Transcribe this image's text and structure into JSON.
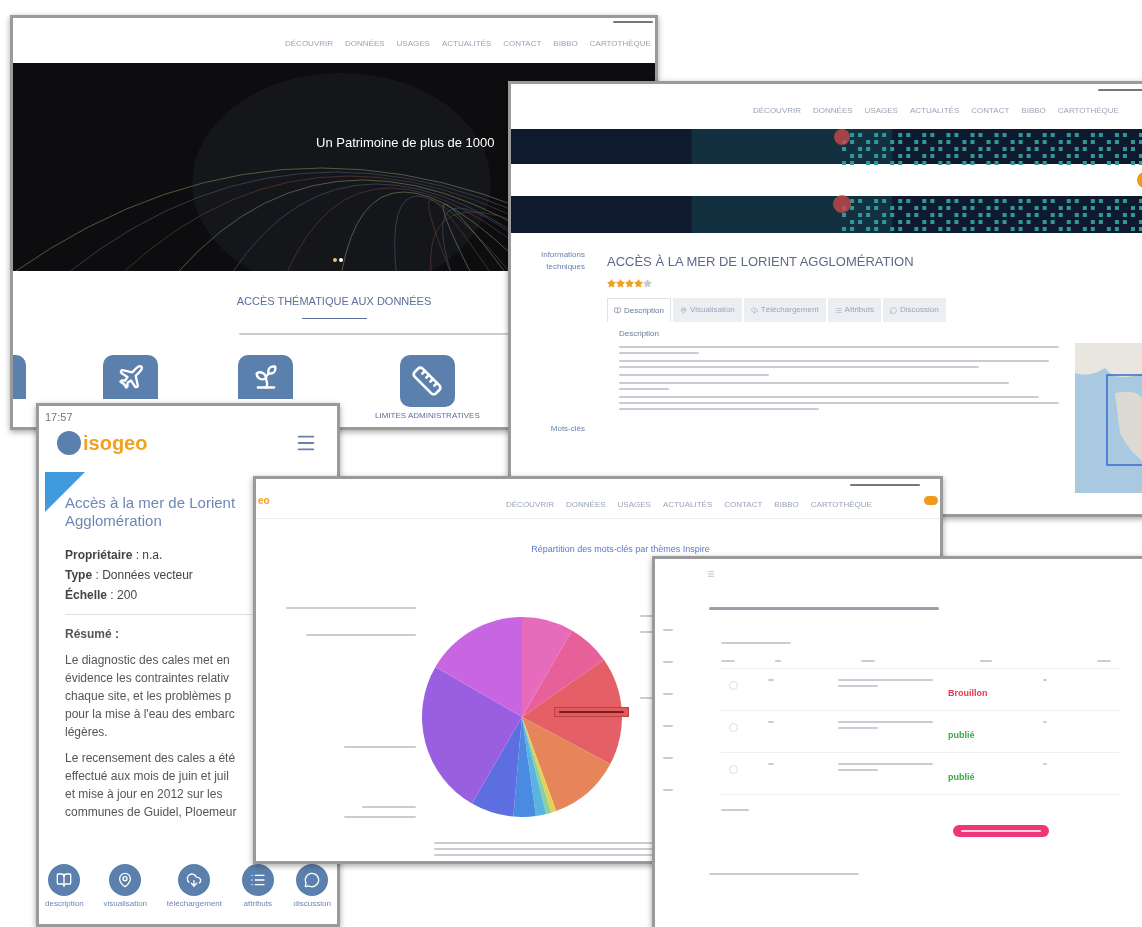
{
  "home_page": {
    "nav": [
      {
        "label": "DÉCOUVRIR"
      },
      {
        "label": "DONNÉES"
      },
      {
        "label": "USAGES"
      },
      {
        "label": "ACTUALITÉS"
      },
      {
        "label": "CONTACT"
      },
      {
        "label": "BIBBO"
      },
      {
        "label": "CARTOTHÈQUE"
      }
    ],
    "hero_text": "Un Patrimoine de plus de 1000",
    "carousel_dots": [
      {
        "selected": true
      },
      {
        "selected": false
      }
    ],
    "section_title": "ACCÈS THÉMATIQUE AUX DONNÉES",
    "theme_tiles": [
      {
        "kind": "partial"
      },
      {
        "kind": "plane"
      },
      {
        "kind": "leaf"
      },
      {
        "kind": "ruler",
        "label": "LIMITES ADMINISTRATIVES"
      }
    ]
  },
  "detail_page": {
    "nav": [
      {
        "label": "DÉCOUVRIR"
      },
      {
        "label": "DONNÉES"
      },
      {
        "label": "USAGES"
      },
      {
        "label": "ACTUALITÉS"
      },
      {
        "label": "CONTACT"
      },
      {
        "label": "BIBBO"
      },
      {
        "label": "CARTOTHÈQUE"
      }
    ],
    "sidebar": [
      "Informations techniques",
      "Mots-clés"
    ],
    "title": "ACCÈS À LA MER DE LORIENT AGGLOMÉRATION",
    "stars": 4,
    "tabs": [
      {
        "kind": "book",
        "label": "Description",
        "selected": true
      },
      {
        "kind": "pin",
        "label": "Visualisation",
        "selected": false
      },
      {
        "kind": "cloud",
        "label": "Téléchargement",
        "selected": false
      },
      {
        "kind": "list",
        "label": "Attributs",
        "selected": false
      },
      {
        "kind": "chat",
        "label": "Discussion",
        "selected": false
      }
    ],
    "section_heading": "Description"
  },
  "mobile_page": {
    "time": "17:57",
    "logo": "isogeo",
    "title_lines": [
      "Accès à la mer de Lorient",
      "Agglomération"
    ],
    "fields": [
      "**Propriétaire** : n.a.",
      "**Type** : Données vecteur",
      "**Échelle** : 200"
    ],
    "summary_label": "Résumé :",
    "paragraphs": [
      [
        "Le diagnostic des cales met en",
        "évidence les contraintes relativ",
        "chaque site, et les problèmes p",
        "pour la mise à l'eau des embarc",
        "légères."
      ],
      [
        "Le recensement des cales a été",
        "effectué aux mois de juin et juil",
        "et mise à jour en 2012 sur les",
        "communes de Guidel, Ploemeur"
      ]
    ],
    "bottom_nav": [
      {
        "kind": "book",
        "label": "description"
      },
      {
        "kind": "pin",
        "label": "visualisation"
      },
      {
        "kind": "cloud",
        "label": "téléchargement"
      },
      {
        "kind": "list",
        "label": "attributs"
      },
      {
        "kind": "chat",
        "label": "discussion"
      }
    ]
  },
  "chart_page": {
    "logo_visible": "eo",
    "nav": [
      {
        "label": "DÉCOUVRIR"
      },
      {
        "label": "DONNÉES"
      },
      {
        "label": "USAGES"
      },
      {
        "label": "ACTUALITÉS"
      },
      {
        "label": "CONTACT"
      },
      {
        "label": "BIBBO"
      },
      {
        "label": "CARTOTHÈQUE"
      }
    ],
    "title": "Répartition des mots-clés par thèmes Inspire"
  },
  "admin_page": {
    "rows": [
      {
        "checked": false,
        "status": "Brouillon",
        "color": "#e8374f"
      },
      {
        "checked": false,
        "status": "publié",
        "color": "#3aa845"
      },
      {
        "checked": false,
        "status": "publié",
        "color": "#3aa845"
      }
    ]
  }
}
